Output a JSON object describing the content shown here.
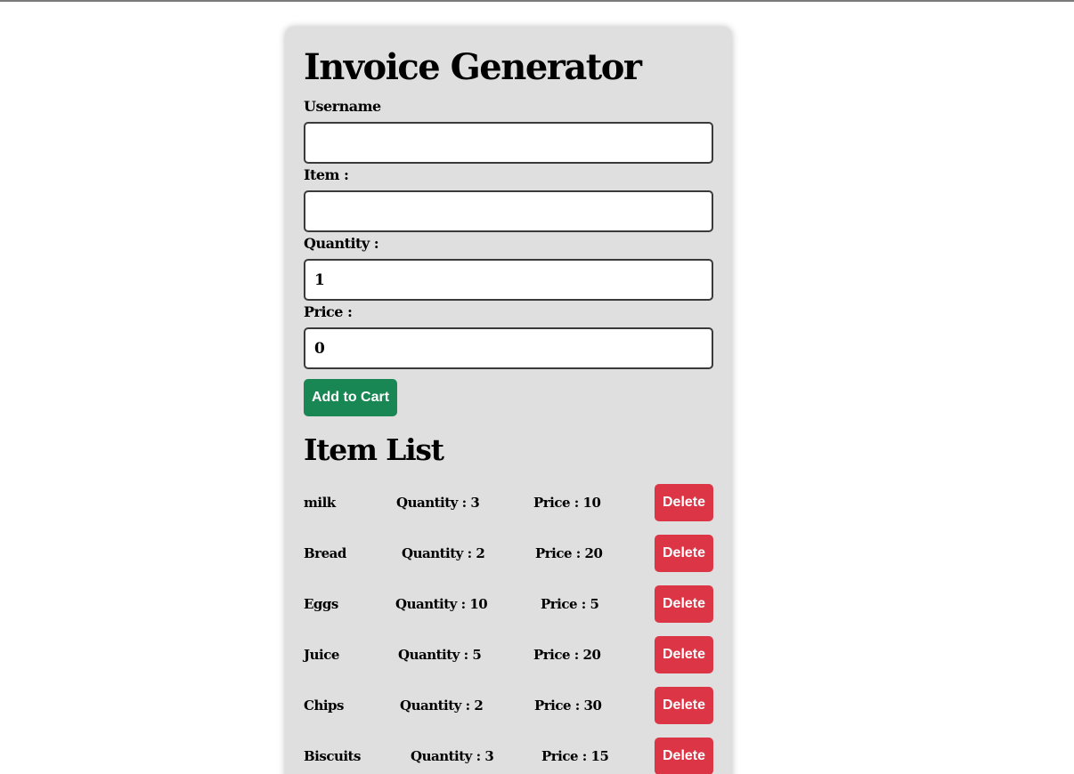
{
  "app": {
    "title": "Invoice Generator"
  },
  "form": {
    "username": {
      "label": "Username",
      "value": ""
    },
    "item": {
      "label": "Item :",
      "value": ""
    },
    "quantity": {
      "label": "Quantity :",
      "value": "1"
    },
    "price": {
      "label": "Price :",
      "value": "0"
    },
    "add_button_label": "Add to Cart"
  },
  "item_list": {
    "title": "Item List",
    "quantity_prefix": "Quantity : ",
    "price_prefix": "Price : ",
    "delete_label": "Delete",
    "items": [
      {
        "name": "milk",
        "quantity": "3",
        "price": "10"
      },
      {
        "name": "Bread",
        "quantity": "2",
        "price": "20"
      },
      {
        "name": "Eggs",
        "quantity": "10",
        "price": "5"
      },
      {
        "name": "Juice",
        "quantity": "5",
        "price": "20"
      },
      {
        "name": "Chips",
        "quantity": "2",
        "price": "30"
      },
      {
        "name": "Biscuits",
        "quantity": "3",
        "price": "15"
      }
    ]
  },
  "colors": {
    "card_background": "#e0dfe0",
    "add_button": "#198754",
    "delete_button": "#dc3545",
    "button_text": "#ffffff"
  }
}
